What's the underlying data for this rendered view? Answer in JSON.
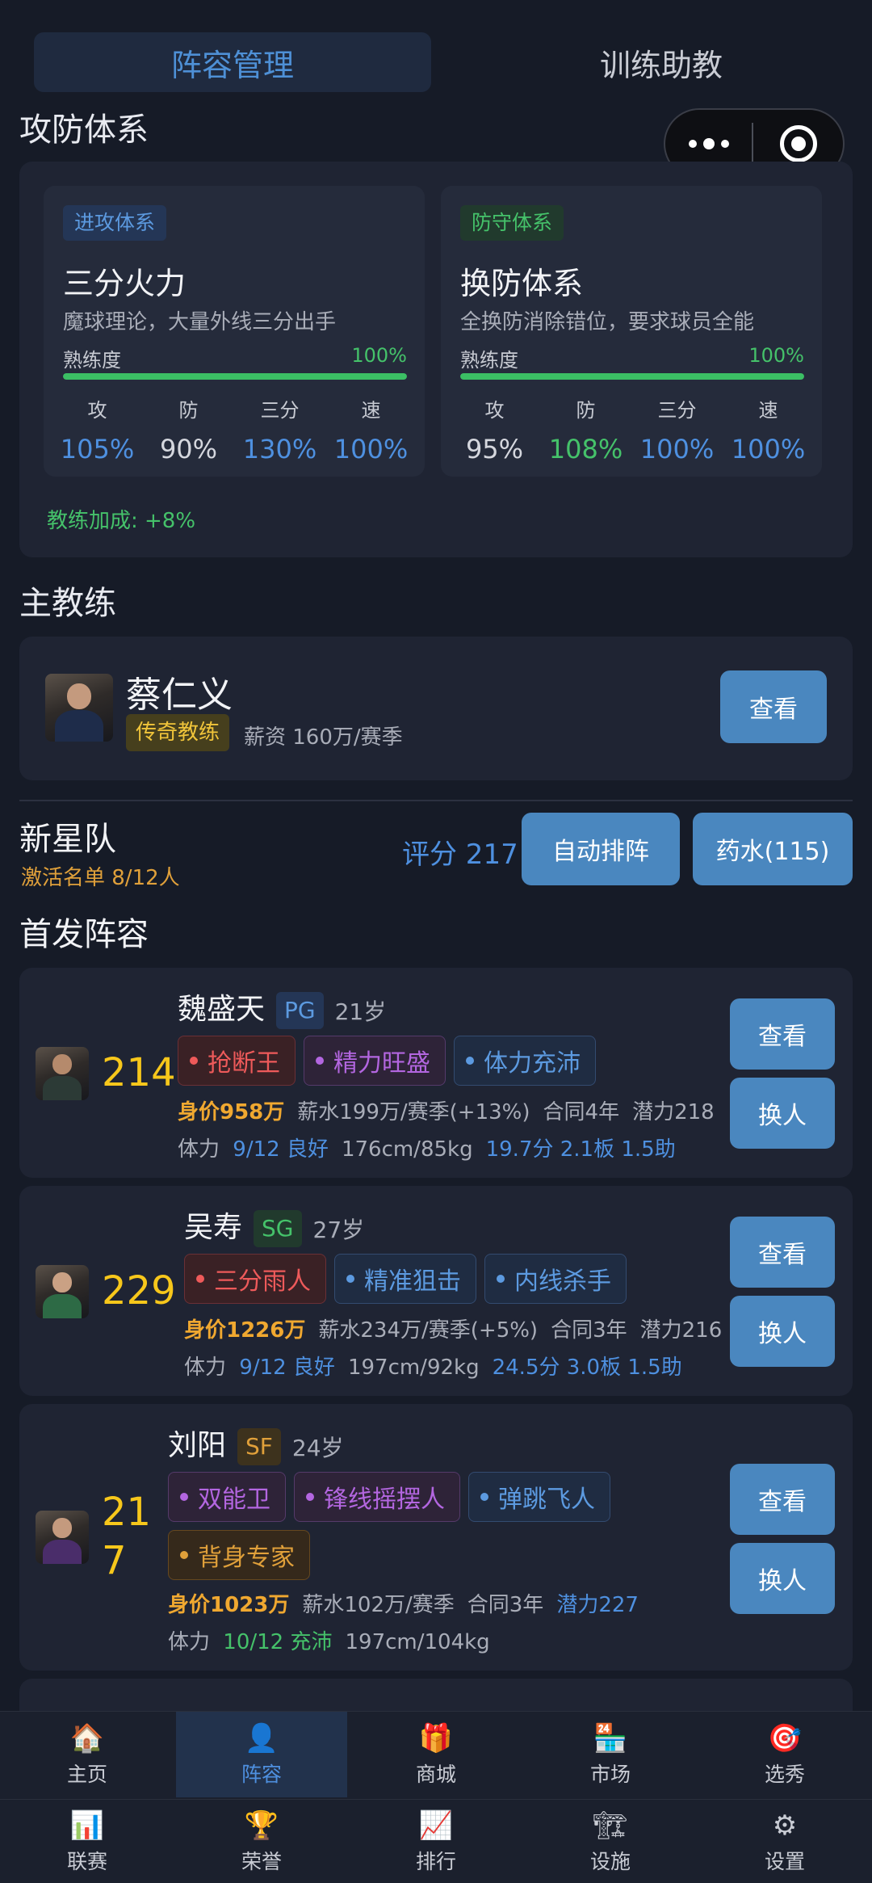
{
  "top_tabs": {
    "active": "阵容管理",
    "inactive": "训练助教"
  },
  "attack_defense": {
    "title": "攻防体系",
    "offense": {
      "tag": "进攻体系",
      "name": "三分火力",
      "desc": "魔球理论，大量外线三分出手",
      "proficiency_label": "熟练度",
      "proficiency_value": "100%",
      "proficiency": 1.0,
      "stats": [
        {
          "label": "攻",
          "value": "105%",
          "color": "#4e90e0"
        },
        {
          "label": "防",
          "value": "90%",
          "color": "#d5d7de"
        },
        {
          "label": "三分",
          "value": "130%",
          "color": "#4e90e0"
        },
        {
          "label": "速",
          "value": "100%",
          "color": "#4e90e0"
        }
      ]
    },
    "defense": {
      "tag": "防守体系",
      "name": "换防体系",
      "desc": "全换防消除错位，要求球员全能",
      "proficiency_label": "熟练度",
      "proficiency_value": "100%",
      "proficiency": 1.0,
      "stats": [
        {
          "label": "攻",
          "value": "95%",
          "color": "#d5d7de"
        },
        {
          "label": "防",
          "value": "108%",
          "color": "#45c26a"
        },
        {
          "label": "三分",
          "value": "100%",
          "color": "#4e90e0"
        },
        {
          "label": "速",
          "value": "100%",
          "color": "#4e90e0"
        }
      ]
    },
    "coach_bonus": "教练加成: +8%"
  },
  "head_coach": {
    "title": "主教练",
    "name": "蔡仁义",
    "badge": "传奇教练",
    "salary": "薪资 160万/赛季",
    "view_label": "查看"
  },
  "team": {
    "name": "新星队",
    "active_roster": "激活名单 8/12人",
    "score": "评分 217",
    "auto_label": "自动排阵",
    "potion_label": "药水(115)"
  },
  "starters": {
    "title": "首发阵容",
    "players": [
      {
        "rating": "214",
        "name": "魏盛天",
        "position": "PG",
        "age": "21岁",
        "traits": [
          {
            "label": "抢断王",
            "color": "red"
          },
          {
            "label": "精力旺盛",
            "color": "purple"
          },
          {
            "label": "体力充沛",
            "color": "blue"
          }
        ],
        "value": "身价958万",
        "salary": "薪水199万/赛季(+13%)",
        "contract": "合同4年",
        "potential": "潜力218",
        "stamina_label": "体力",
        "stamina": "9/12 良好",
        "body": "176cm/85kg",
        "stats": "19.7分 2.1板 1.5助",
        "view_label": "查看",
        "swap_label": "换人"
      },
      {
        "rating": "229",
        "name": "吴寿",
        "position": "SG",
        "age": "27岁",
        "traits": [
          {
            "label": "三分雨人",
            "color": "red"
          },
          {
            "label": "精准狙击",
            "color": "blue"
          },
          {
            "label": "内线杀手",
            "color": "blue"
          }
        ],
        "value": "身价1226万",
        "salary": "薪水234万/赛季(+5%)",
        "contract": "合同3年",
        "potential": "潜力216",
        "stamina_label": "体力",
        "stamina": "9/12 良好",
        "body": "197cm/92kg",
        "stats": "24.5分 3.0板 1.5助",
        "view_label": "查看",
        "swap_label": "换人"
      },
      {
        "rating_line1": "21",
        "rating_line2": "7",
        "name": "刘阳",
        "position": "SF",
        "age": "24岁",
        "traits": [
          {
            "label": "双能卫",
            "color": "purple"
          },
          {
            "label": "锋线摇摆人",
            "color": "purple"
          },
          {
            "label": "弹跳飞人",
            "color": "blue"
          },
          {
            "label": "背身专家",
            "color": "orange"
          }
        ],
        "value": "身价1023万",
        "salary": "薪水102万/赛季",
        "contract": "合同3年",
        "potential": "潜力227",
        "stamina_label": "体力",
        "stamina": "10/12 充沛",
        "body": "197cm/104kg",
        "view_label": "查看",
        "swap_label": "换人"
      }
    ]
  },
  "nav": {
    "row1": [
      {
        "label": "主页",
        "icon": "home-icon"
      },
      {
        "label": "阵容",
        "icon": "roster-icon"
      },
      {
        "label": "商城",
        "icon": "gift-icon"
      },
      {
        "label": "市场",
        "icon": "market-icon"
      },
      {
        "label": "选秀",
        "icon": "target-icon"
      }
    ],
    "row2": [
      {
        "label": "联赛",
        "icon": "chart-icon"
      },
      {
        "label": "荣誉",
        "icon": "trophy-icon"
      },
      {
        "label": "排行",
        "icon": "trend-icon"
      },
      {
        "label": "设施",
        "icon": "crane-icon"
      },
      {
        "label": "设置",
        "icon": "gear-icon"
      }
    ]
  }
}
